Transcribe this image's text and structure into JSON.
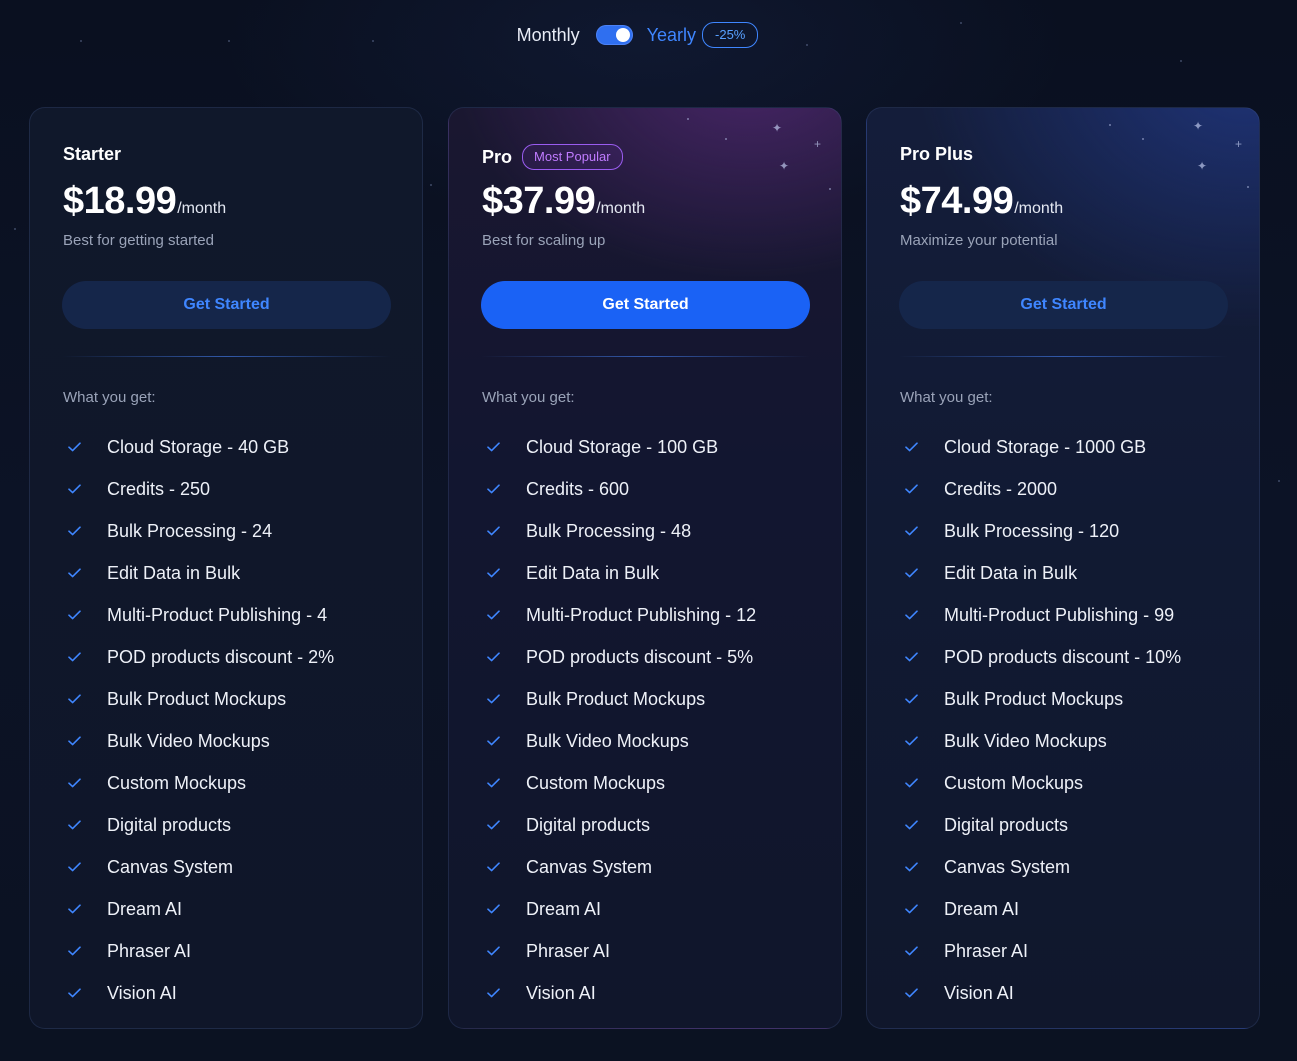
{
  "billing": {
    "monthly_label": "Monthly",
    "yearly_label": "Yearly",
    "discount_badge": "-25%",
    "toggle_state": "yearly"
  },
  "colors": {
    "accent": "#1a62f5",
    "accent_text": "#3f86ff",
    "popular": "#c07bff",
    "background": "#0b1120"
  },
  "what_you_get_label": "What you get:",
  "cta_label": "Get Started",
  "plans": [
    {
      "name": "Starter",
      "price": "$18.99",
      "period": "/month",
      "tagline": "Best for getting started",
      "cta": "Get Started",
      "features": [
        "Cloud Storage - 40 GB",
        "Credits - 250",
        "Bulk Processing - 24",
        "Edit Data in Bulk",
        "Multi-Product Publishing - 4",
        "POD products discount - 2%",
        "Bulk Product Mockups",
        "Bulk Video Mockups",
        "Custom Mockups",
        "Digital products",
        "Canvas System",
        "Dream AI",
        "Phraser AI",
        "Vision AI"
      ]
    },
    {
      "name": "Pro",
      "badge": "Most Popular",
      "price": "$37.99",
      "period": "/month",
      "tagline": "Best for scaling up",
      "cta": "Get Started",
      "features": [
        "Cloud Storage - 100 GB",
        "Credits - 600",
        "Bulk Processing - 48",
        "Edit Data in Bulk",
        "Multi-Product Publishing - 12",
        "POD products discount - 5%",
        "Bulk Product Mockups",
        "Bulk Video Mockups",
        "Custom Mockups",
        "Digital products",
        "Canvas System",
        "Dream AI",
        "Phraser AI",
        "Vision AI"
      ]
    },
    {
      "name": "Pro Plus",
      "price": "$74.99",
      "period": "/month",
      "tagline": "Maximize your potential",
      "cta": "Get Started",
      "features": [
        "Cloud Storage - 1000 GB",
        "Credits - 2000",
        "Bulk Processing - 120",
        "Edit Data in Bulk",
        "Multi-Product Publishing - 99",
        "POD products discount - 10%",
        "Bulk Product Mockups",
        "Bulk Video Mockups",
        "Custom Mockups",
        "Digital products",
        "Canvas System",
        "Dream AI",
        "Phraser AI",
        "Vision AI"
      ]
    }
  ]
}
